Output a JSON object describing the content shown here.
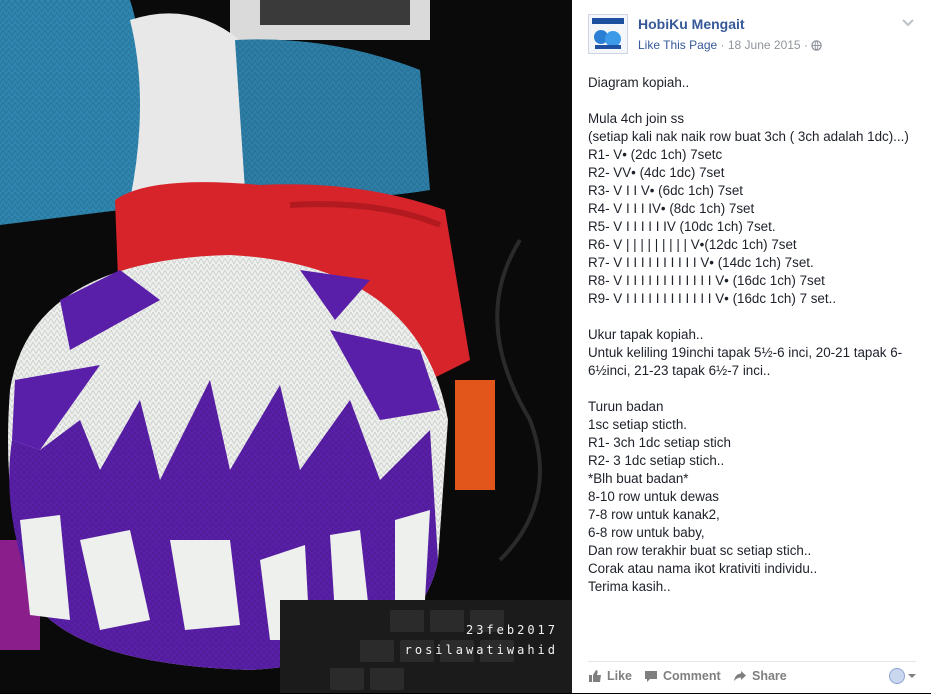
{
  "photo": {
    "stamp_date": "23feb2017",
    "stamp_name": "rosilawatiwahid",
    "hat_colors": {
      "white": "#eef0ee",
      "purple": "#5a1fa8",
      "blue_yarn": "#2f86b0",
      "red_bag": "#d7242b"
    }
  },
  "post": {
    "page_name": "HobiKu Mengait",
    "like_link": "Like This Page",
    "separator": "·",
    "date": "18 June 2015",
    "separator2": "·",
    "audience_icon": "globe-icon",
    "body": "Diagram kopiah..\n\nMula 4ch join ss\n(setiap kali nak naik row buat 3ch ( 3ch adalah 1dc)...)\nR1- V• (2dc 1ch) 7setc\nR2- VV• (4dc 1dc) 7set\nR3- V I I V• (6dc 1ch) 7set\nR4- V I I I IV• (8dc 1ch) 7set\nR5- V I I I I I IV (10dc 1ch) 7set.\nR6- V | | | | | | | | | V•(12dc 1ch) 7set\nR7- V I I I I I I I I I I V• (14dc 1ch) 7set.\nR8- V I I I I I I I I I I I I V• (16dc 1ch) 7set\nR9- V I I I I I I I I I I I I V• (16dc 1ch) 7 set..\n\nUkur tapak kopiah..\nUntuk keliling 19inchi tapak 5½-6 inci, 20-21 tapak 6-6½inci, 21-23 tapak 6½-7 inci..\n\nTurun badan\n1sc setiap sticth.\nR1- 3ch 1dc setiap stich\nR2- 3 1dc setiap stich..\n*Blh buat badan*\n8-10 row untuk dewas\n7-8 row untuk kanak2,\n6-8 row untuk baby,\nDan row terakhir buat sc setiap stich..\nCorak atau nama ikot krativiti individu..\nTerima kasih.."
  },
  "actions": {
    "like": "Like",
    "comment": "Comment",
    "share": "Share"
  },
  "colors": {
    "link": "#365899",
    "meta": "#90949c",
    "text": "#1d2129"
  }
}
